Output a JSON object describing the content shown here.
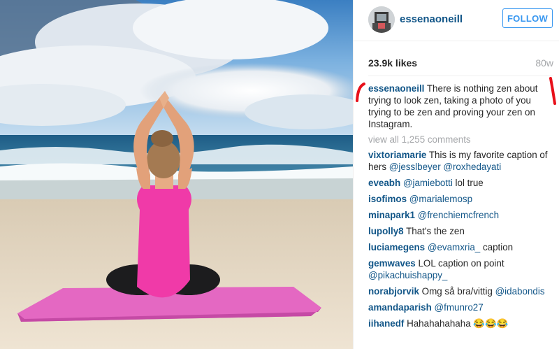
{
  "post": {
    "username": "essenaoneill",
    "follow_label": "FOLLOW",
    "likes": "23.9k likes",
    "age": "80w",
    "caption_user": "essenaoneill",
    "caption_text": " There is nothing zen about trying to look zen, taking a photo of you trying to be zen and proving your zen on Instagram.",
    "view_all": "view all 1,255 comments"
  },
  "comments": [
    {
      "user": "vixtoriamarie",
      "text": " This is my favorite caption of hers ",
      "mentions": "@jesslbeyer @roxhedayati"
    },
    {
      "user": "eveabh",
      "text": " ",
      "mentions": "@jamiebotti",
      "after": " lol true"
    },
    {
      "user": "isofimos",
      "text": " ",
      "mentions": "@marialemosp"
    },
    {
      "user": "minapark1",
      "text": " ",
      "mentions": "@frenchiemcfrench"
    },
    {
      "user": "lupolly8",
      "text": " That's the zen"
    },
    {
      "user": "luciamegens",
      "text": " ",
      "mentions": "@evamxria_",
      "after": " caption"
    },
    {
      "user": "gemwaves",
      "text": " LOL caption on point ",
      "mentions": "@pikachuishappy_"
    },
    {
      "user": "norabjorvik",
      "text": " Omg så bra/vittig ",
      "mentions": "@idabondis"
    },
    {
      "user": "amandaparish",
      "text": " ",
      "mentions": "@fmunro27"
    },
    {
      "user": "iihanedf",
      "text": " Hahahahahaha 😂😂😂"
    }
  ],
  "colors": {
    "link": "#125688",
    "follow": "#3897f0",
    "annotation": "#e8101a",
    "muted": "#a5a7aa"
  }
}
